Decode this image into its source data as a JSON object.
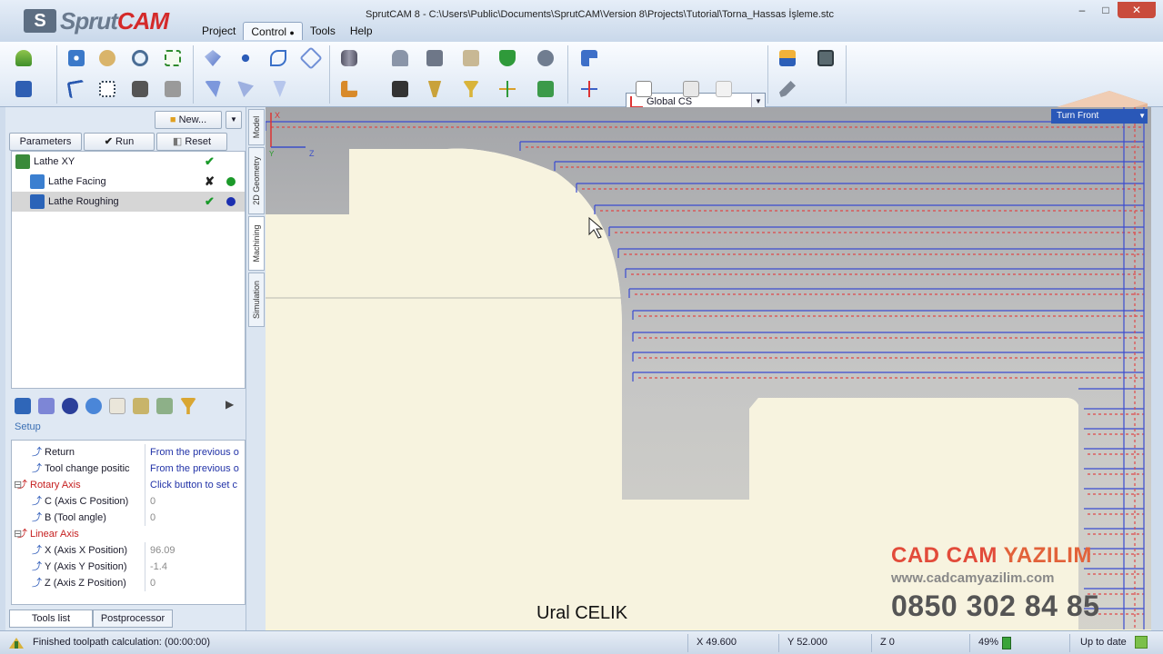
{
  "app": {
    "logo_prefix": "Sprut",
    "logo_suffix": "CAM",
    "window_title": "SprutCAM 8 - C:\\Users\\Public\\Documents\\SprutCAM\\Version 8\\Projects\\Tutorial\\Torna_Hassas İşleme.stc",
    "menu": [
      "Project",
      "Control",
      "Tools",
      "Help"
    ],
    "active_menu": "Control",
    "window_controls": [
      "–",
      "□",
      "✕"
    ]
  },
  "ribbon": {
    "coordinate_system": "Global CS"
  },
  "left_panel": {
    "new_button": "New...",
    "parameters_button": "Parameters",
    "run_button": "Run",
    "reset_button": "Reset",
    "operations": [
      {
        "name": "Lathe XY",
        "status": "ok",
        "dot": ""
      },
      {
        "name": "Lathe Facing",
        "status": "error",
        "dot": "#1c9a2a"
      },
      {
        "name": "Lathe Roughing",
        "status": "ok",
        "dot": "#1c2fb0"
      }
    ],
    "setup_label": "Setup",
    "properties": [
      {
        "name": "Return",
        "value": "From the previous o",
        "name_style": "",
        "value_style": "blue",
        "indent": 1
      },
      {
        "name": "Tool change positic",
        "value": "From the previous o",
        "name_style": "",
        "value_style": "blue",
        "indent": 1
      },
      {
        "name": "Rotary Axis",
        "value": "Click button to set c",
        "name_style": "red",
        "value_style": "blue",
        "indent": 0
      },
      {
        "name": "C (Axis C Position)",
        "value": "0",
        "name_style": "",
        "value_style": "grey",
        "indent": 1
      },
      {
        "name": "B (Tool angle)",
        "value": "0",
        "name_style": "",
        "value_style": "grey",
        "indent": 1
      },
      {
        "name": "Linear Axis",
        "value": "",
        "name_style": "red",
        "value_style": "",
        "indent": 0
      },
      {
        "name": "X (Axis X Position)",
        "value": "96.09",
        "name_style": "",
        "value_style": "grey",
        "indent": 1
      },
      {
        "name": "Y (Axis Y Position)",
        "value": "-1.4",
        "name_style": "",
        "value_style": "grey",
        "indent": 1
      },
      {
        "name": "Z (Axis Z Position)",
        "value": "0",
        "name_style": "",
        "value_style": "grey",
        "indent": 1
      }
    ],
    "bottom_tabs": [
      "Tools list",
      "Postprocessor"
    ]
  },
  "vertical_tabs": [
    "Model",
    "2D Geometry",
    "Machining",
    "Simulation"
  ],
  "active_vertical_tab": "Machining",
  "viewport": {
    "view_name": "Turn Front",
    "triad_x": "X",
    "triad_z": "Z",
    "triad_y": "Y",
    "brand_name_a": "CAD CAM",
    "brand_name_b": "YAZILIM",
    "brand_url": "www.cadcamyazilim.com",
    "brand_phone": "0850 302 84 85",
    "author": "Ural CELIK"
  },
  "status_bar": {
    "message": "Finished toolpath calculation:  (00:00:00)",
    "x": "X 49.600",
    "y": "Y 52.000",
    "z": "Z 0",
    "memory": "49%",
    "state": "Up to date"
  },
  "colors": {
    "toolpath_blue": "#3a4bd0",
    "toolpath_red": "#e04848",
    "part_grey": "#a9abb0",
    "selected_row": "#d6d6d6"
  }
}
